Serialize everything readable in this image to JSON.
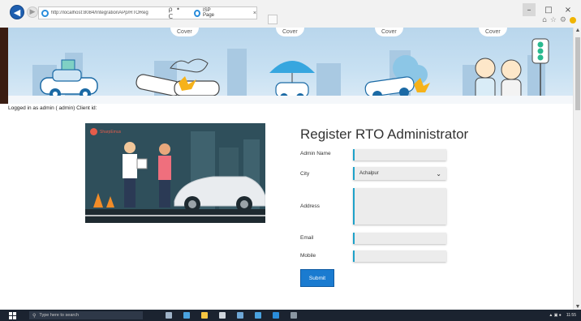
{
  "browser": {
    "url": "http://localhost:8084/IntegrationAPp/RTOReg",
    "tab_title": "ISP Page",
    "addr_tools": "ρ • C",
    "tab_close": "×"
  },
  "window": {
    "min": "–",
    "max": "□",
    "close": "×"
  },
  "banner": {
    "covers": [
      "Cover",
      "Cover",
      "Cover",
      "Cover"
    ]
  },
  "page": {
    "logged_in_text": "Logged in as admin ( admin) Client id:",
    "hero_logo_text": "SharpEmus"
  },
  "form": {
    "title": "Register RTO Administrator",
    "labels": {
      "admin_name": "Admin Name",
      "city": "City",
      "address": "Address",
      "email": "Email",
      "mobile": "Mobile"
    },
    "values": {
      "admin_name": "",
      "city": "Achalpur",
      "address": "",
      "email": "",
      "mobile": ""
    },
    "submit_label": "Submit"
  },
  "taskbar": {
    "search_placeholder": "Type here to search",
    "time": "11:55"
  },
  "colors": {
    "accent": "#1a7bd0",
    "field_border": "#1fa2c9",
    "taskbar": "#1b2330"
  }
}
